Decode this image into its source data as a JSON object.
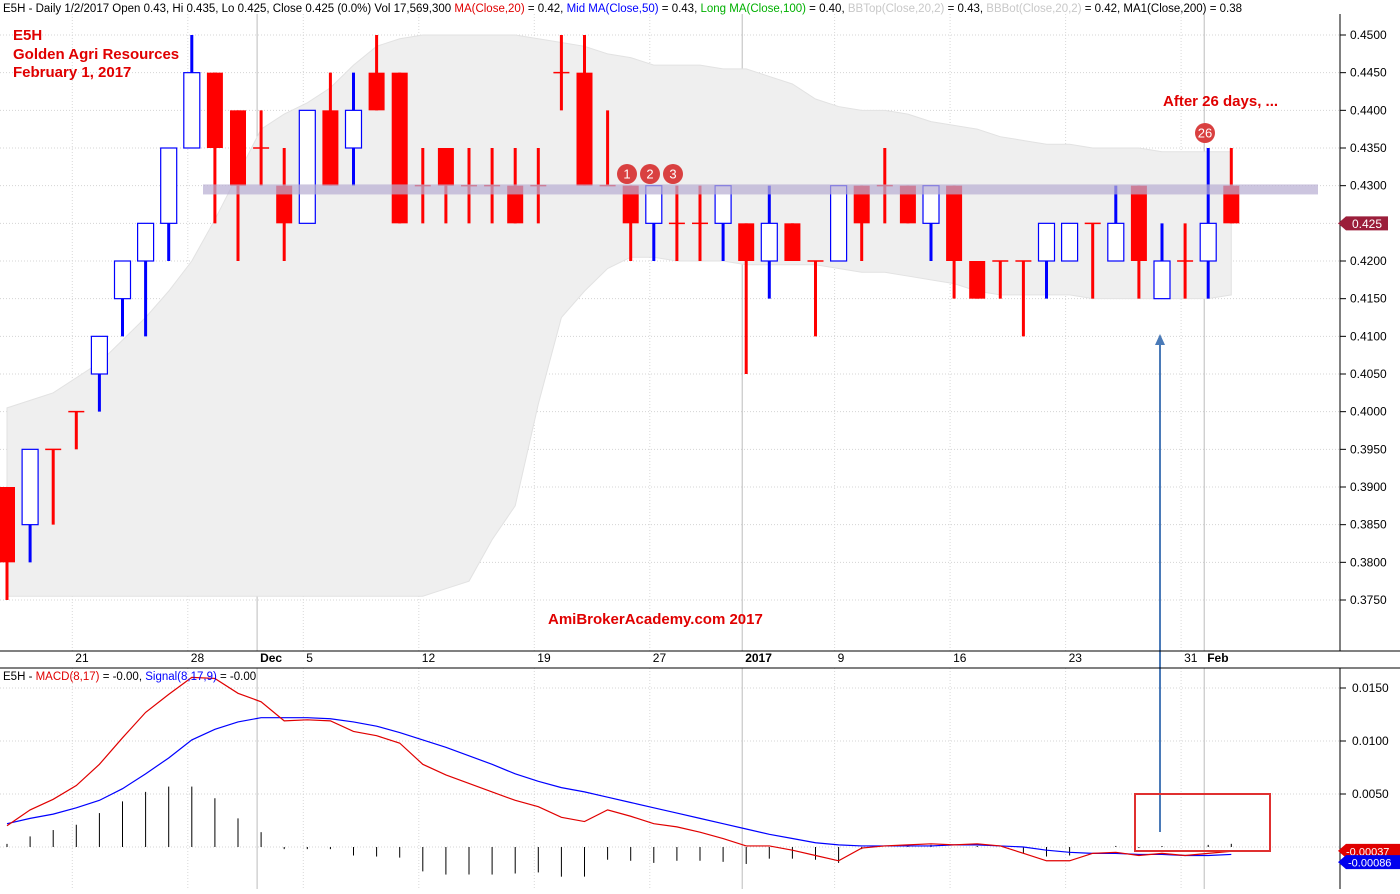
{
  "header": {
    "ticker": "E5H",
    "segments": [
      {
        "text": "E5H - Daily 1/2/2017 Open 0.43, Hi 0.435, Lo 0.425, Close 0.425 (0.0%) Vol 17,569,300 ",
        "color": "#000000"
      },
      {
        "text": "MA(Close,20)",
        "color": "#e00000"
      },
      {
        "text": " = 0.42, ",
        "color": "#000000"
      },
      {
        "text": "Mid MA(Close,50)",
        "color": "#0000ff"
      },
      {
        "text": " = 0.43, ",
        "color": "#000000"
      },
      {
        "text": "Long MA(Close,100)",
        "color": "#00b000"
      },
      {
        "text": " = 0.40, ",
        "color": "#000000"
      },
      {
        "text": "BBTop(Close,20,2)",
        "color": "#c8c8c8"
      },
      {
        "text": " = 0.43, ",
        "color": "#000000"
      },
      {
        "text": "BBBot(Close,20,2)",
        "color": "#c8c8c8"
      },
      {
        "text": " = 0.42, MA1(Close,200) = 0.38",
        "color": "#000000"
      }
    ]
  },
  "annotations": {
    "title_lines": [
      "E5H",
      "Golden Agri Resources",
      "February 1, 2017"
    ],
    "watermark": "AmiBrokerAcademy.com   2017",
    "after_days": "After 26 days, ...",
    "markers": [
      "1",
      "2",
      "3",
      "26"
    ]
  },
  "macd_header": {
    "segments": [
      {
        "text": "E5H - ",
        "color": "#000000"
      },
      {
        "text": "MACD(8,17)",
        "color": "#e00000"
      },
      {
        "text": " = -0.00, ",
        "color": "#000000"
      },
      {
        "text": "Signal(8,17,9)",
        "color": "#0000ff"
      },
      {
        "text": " = -0.00",
        "color": "#000000"
      }
    ]
  },
  "colors": {
    "up": "#0000ff",
    "down": "#ff0000",
    "band_fill": "#efefef",
    "resistance": "#b9aed2",
    "macd": "#e00000",
    "signal": "#0000ff",
    "price_tag": "#9b1e3a",
    "marker": "#d94040"
  },
  "chart_data": [
    {
      "type": "candlestick",
      "title": "E5H - Daily 1/2/2017",
      "ylim": [
        0.3725,
        0.4515
      ],
      "y_ticks": [
        "0.3750",
        "0.3800",
        "0.3850",
        "0.3900",
        "0.3950",
        "0.4000",
        "0.4050",
        "0.4100",
        "0.4150",
        "0.4200",
        "0.4250",
        "0.4300",
        "0.4350",
        "0.4400",
        "0.4450",
        "0.4500"
      ],
      "y_tick_values": [
        0.375,
        0.38,
        0.385,
        0.39,
        0.395,
        0.4,
        0.405,
        0.41,
        0.415,
        0.42,
        0.425,
        0.43,
        0.435,
        0.44,
        0.445,
        0.45
      ],
      "x_tick_labels": [
        {
          "index": 3,
          "label": "21",
          "bold": false
        },
        {
          "index": 8,
          "label": "28",
          "bold": false
        },
        {
          "index": 11,
          "label": "Dec",
          "bold": true
        },
        {
          "index": 13,
          "label": "5",
          "bold": false
        },
        {
          "index": 18,
          "label": "12",
          "bold": false
        },
        {
          "index": 23,
          "label": "19",
          "bold": false
        },
        {
          "index": 28,
          "label": "27",
          "bold": false
        },
        {
          "index": 32,
          "label": "2017",
          "bold": true
        },
        {
          "index": 36,
          "label": "9",
          "bold": false
        },
        {
          "index": 41,
          "label": "16",
          "bold": false
        },
        {
          "index": 46,
          "label": "23",
          "bold": false
        },
        {
          "index": 51,
          "label": "31",
          "bold": false
        },
        {
          "index": 52,
          "label": "Feb",
          "bold": true
        }
      ],
      "last_price": "0.425",
      "resistance_level": 0.4295,
      "ohlc": [
        [
          0.39,
          0.39,
          0.375,
          0.38
        ],
        [
          0.385,
          0.395,
          0.38,
          0.395
        ],
        [
          0.395,
          0.395,
          0.385,
          0.395
        ],
        [
          0.4,
          0.4,
          0.395,
          0.4
        ],
        [
          0.405,
          0.41,
          0.4,
          0.41
        ],
        [
          0.415,
          0.42,
          0.41,
          0.42
        ],
        [
          0.42,
          0.425,
          0.41,
          0.425
        ],
        [
          0.425,
          0.435,
          0.42,
          0.435
        ],
        [
          0.435,
          0.45,
          0.435,
          0.445
        ],
        [
          0.445,
          0.445,
          0.425,
          0.435
        ],
        [
          0.44,
          0.44,
          0.42,
          0.43
        ],
        [
          0.435,
          0.44,
          0.43,
          0.435
        ],
        [
          0.43,
          0.435,
          0.42,
          0.425
        ],
        [
          0.425,
          0.44,
          0.425,
          0.44
        ],
        [
          0.44,
          0.445,
          0.43,
          0.43
        ],
        [
          0.435,
          0.445,
          0.43,
          0.44
        ],
        [
          0.445,
          0.45,
          0.44,
          0.44
        ],
        [
          0.445,
          0.445,
          0.425,
          0.425
        ],
        [
          0.43,
          0.435,
          0.425,
          0.43
        ],
        [
          0.435,
          0.435,
          0.425,
          0.43
        ],
        [
          0.43,
          0.435,
          0.425,
          0.43
        ],
        [
          0.43,
          0.435,
          0.425,
          0.43
        ],
        [
          0.43,
          0.435,
          0.425,
          0.425
        ],
        [
          0.43,
          0.435,
          0.425,
          0.43
        ],
        [
          0.445,
          0.45,
          0.44,
          0.445
        ],
        [
          0.445,
          0.45,
          0.43,
          0.43
        ],
        [
          0.43,
          0.44,
          0.43,
          0.43
        ],
        [
          0.43,
          0.43,
          0.42,
          0.425
        ],
        [
          0.425,
          0.43,
          0.42,
          0.43
        ],
        [
          0.425,
          0.43,
          0.42,
          0.425
        ],
        [
          0.425,
          0.43,
          0.42,
          0.425
        ],
        [
          0.425,
          0.43,
          0.42,
          0.43
        ],
        [
          0.425,
          0.425,
          0.405,
          0.42
        ],
        [
          0.42,
          0.43,
          0.415,
          0.425
        ],
        [
          0.425,
          0.425,
          0.42,
          0.42
        ],
        [
          0.42,
          0.42,
          0.41,
          0.42
        ],
        [
          0.42,
          0.43,
          0.42,
          0.43
        ],
        [
          0.43,
          0.43,
          0.42,
          0.425
        ],
        [
          0.43,
          0.435,
          0.425,
          0.43
        ],
        [
          0.43,
          0.43,
          0.425,
          0.425
        ],
        [
          0.425,
          0.43,
          0.42,
          0.43
        ],
        [
          0.43,
          0.43,
          0.415,
          0.42
        ],
        [
          0.42,
          0.42,
          0.415,
          0.415
        ],
        [
          0.42,
          0.42,
          0.415,
          0.42
        ],
        [
          0.42,
          0.42,
          0.41,
          0.42
        ],
        [
          0.42,
          0.425,
          0.415,
          0.425
        ],
        [
          0.42,
          0.425,
          0.42,
          0.425
        ],
        [
          0.425,
          0.425,
          0.415,
          0.425
        ],
        [
          0.42,
          0.43,
          0.42,
          0.425
        ],
        [
          0.43,
          0.43,
          0.415,
          0.42
        ],
        [
          0.415,
          0.425,
          0.415,
          0.42
        ],
        [
          0.42,
          0.425,
          0.415,
          0.42
        ],
        [
          0.42,
          0.435,
          0.415,
          0.425
        ],
        [
          0.43,
          0.435,
          0.425,
          0.425
        ]
      ],
      "bb_upper": [
        0.4005,
        0.4015,
        0.4025,
        0.4045,
        0.4065,
        0.4095,
        0.4125,
        0.416,
        0.42,
        0.4255,
        0.4315,
        0.4375,
        0.4395,
        0.441,
        0.443,
        0.446,
        0.4485,
        0.4495,
        0.45,
        0.45,
        0.45,
        0.45,
        0.45,
        0.4495,
        0.449,
        0.4485,
        0.4475,
        0.447,
        0.446,
        0.446,
        0.446,
        0.4455,
        0.4455,
        0.4445,
        0.4435,
        0.4415,
        0.4405,
        0.44,
        0.44,
        0.4395,
        0.4385,
        0.438,
        0.4375,
        0.4365,
        0.436,
        0.4355,
        0.4355,
        0.435,
        0.435,
        0.435,
        0.4345,
        0.4345,
        0.4345,
        0.4345
      ],
      "bb_lower": [
        0.3755,
        0.3755,
        0.3755,
        0.3755,
        0.3755,
        0.3755,
        0.3755,
        0.3755,
        0.3755,
        0.3755,
        0.3755,
        0.3755,
        0.3755,
        0.3755,
        0.3755,
        0.3755,
        0.3755,
        0.3755,
        0.3755,
        0.3765,
        0.3775,
        0.383,
        0.3875,
        0.401,
        0.4125,
        0.416,
        0.419,
        0.4205,
        0.4205,
        0.42,
        0.42,
        0.42,
        0.4195,
        0.4195,
        0.4195,
        0.4195,
        0.419,
        0.4185,
        0.4185,
        0.418,
        0.4175,
        0.417,
        0.416,
        0.4155,
        0.4155,
        0.4155,
        0.4155,
        0.415,
        0.415,
        0.415,
        0.415,
        0.415,
        0.415,
        0.4155
      ]
    },
    {
      "type": "line",
      "title": "E5H - MACD(8,17) = -0.00, Signal(8,17,9) = -0.00",
      "ylim": [
        -0.0038,
        0.0173
      ],
      "y_ticks": [
        "0.0150",
        "0.0100",
        "0.0050"
      ],
      "y_tick_values": [
        0.015,
        0.01,
        0.005
      ],
      "last_macd": "-0.00037",
      "last_signal": "-0.00086",
      "series": [
        {
          "name": "MACD(8,17)",
          "values": [
            0.002,
            0.0035,
            0.0045,
            0.0058,
            0.0078,
            0.0103,
            0.0127,
            0.0144,
            0.016,
            0.0159,
            0.0145,
            0.0137,
            0.0119,
            0.012,
            0.0119,
            0.0109,
            0.0105,
            0.0098,
            0.0078,
            0.0068,
            0.006,
            0.0052,
            0.0044,
            0.0038,
            0.0028,
            0.0024,
            0.0035,
            0.0029,
            0.0022,
            0.0019,
            0.0014,
            0.0008,
            0.0001,
            0.0001,
            -0.0003,
            -0.0008,
            -0.0013,
            -0.0001,
            0.0001,
            0.0002,
            0.0003,
            0.0002,
            0.0003,
            0.0001,
            -0.0006,
            -0.0013,
            -0.0013,
            -0.0006,
            -0.0005,
            -0.0008,
            -0.0006,
            -0.0008,
            -0.0006,
            -0.0004
          ]
        },
        {
          "name": "Signal(8,17,9)",
          "values": [
            0.0022,
            0.0027,
            0.0031,
            0.0037,
            0.0044,
            0.0055,
            0.0069,
            0.0084,
            0.0101,
            0.0111,
            0.0118,
            0.0122,
            0.0122,
            0.0122,
            0.0121,
            0.0118,
            0.0114,
            0.0108,
            0.0101,
            0.0094,
            0.0086,
            0.0078,
            0.0069,
            0.0062,
            0.0056,
            0.0052,
            0.0047,
            0.0042,
            0.0037,
            0.0032,
            0.0027,
            0.0022,
            0.0017,
            0.0012,
            0.0008,
            0.0004,
            0.0002,
            0.0001,
            0.0001,
            0.0001,
            0.0001,
            0.0002,
            0.0002,
            0.0001,
            0,
            -0.0003,
            -0.0005,
            -0.0006,
            -0.0006,
            -0.0007,
            -0.0007,
            -0.0008,
            -0.0008,
            -0.0007
          ]
        },
        {
          "name": "Histogram",
          "values": [
            0.0003,
            0.001,
            0.0016,
            0.0021,
            0.0032,
            0.0043,
            0.0052,
            0.0057,
            0.0057,
            0.0046,
            0.0027,
            0.0014,
            -0.0002,
            -0.0002,
            -0.0002,
            -0.0008,
            -0.0009,
            -0.001,
            -0.0023,
            -0.0026,
            -0.0026,
            -0.0026,
            -0.0025,
            -0.0024,
            -0.0028,
            -0.0028,
            -0.0012,
            -0.0013,
            -0.0015,
            -0.0013,
            -0.0013,
            -0.0014,
            -0.0016,
            -0.0011,
            -0.0011,
            -0.0012,
            -0.0015,
            -0.0002,
            0,
            0.0001,
            0.0002,
            0,
            0.0001,
            0,
            -0.0006,
            -0.0009,
            -0.0008,
            0,
            0.0001,
            -0.0001,
            0.0001,
            0,
            0.0002,
            0.0003
          ]
        }
      ]
    }
  ]
}
